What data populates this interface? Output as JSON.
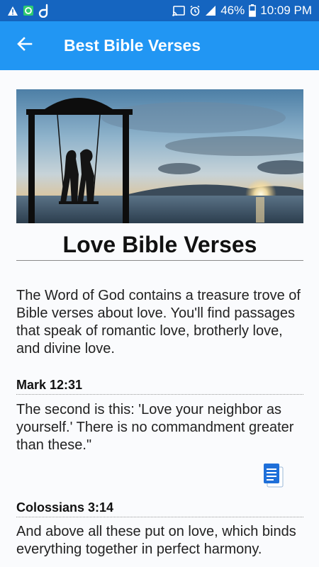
{
  "status_bar": {
    "battery": "46%",
    "time": "10:09 PM",
    "icons": [
      "warning-icon",
      "app-icon",
      "d-icon",
      "cast-icon",
      "alarm-icon",
      "signal-icon",
      "battery-icon"
    ]
  },
  "app_bar": {
    "title": "Best Bible Verses",
    "back_icon": "arrow-back-icon"
  },
  "article": {
    "title": "Love Bible Verses",
    "intro": "The Word of God contains a treasure trove of Bible verses about love. You'll find passages that speak of romantic love, brotherly love, and divine love.",
    "verses": [
      {
        "reference": "Mark 12:31",
        "text": "The second is this: 'Love your neighbor as yourself.' There is no commandment greater than these.\""
      },
      {
        "reference": "Colossians 3:14",
        "text": "And above all these put on love, which binds everything together in perfect harmony."
      }
    ]
  },
  "colors": {
    "status_bar": "#1565c0",
    "app_bar": "#2196f3",
    "copy_icon": "#1e6fd9"
  }
}
